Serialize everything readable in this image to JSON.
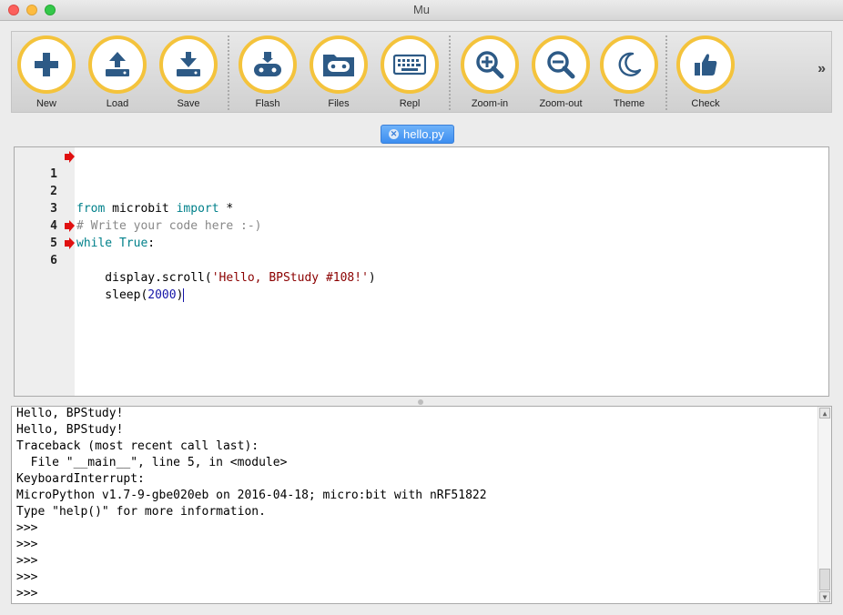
{
  "window": {
    "title": "Mu"
  },
  "toolbar": {
    "buttons": [
      {
        "label": "New",
        "icon": "plus-icon"
      },
      {
        "label": "Load",
        "icon": "upload-icon"
      },
      {
        "label": "Save",
        "icon": "download-icon"
      },
      {
        "label": "Flash",
        "icon": "flash-device-icon"
      },
      {
        "label": "Files",
        "icon": "files-device-icon"
      },
      {
        "label": "Repl",
        "icon": "keyboard-icon"
      },
      {
        "label": "Zoom-in",
        "icon": "zoom-in-icon"
      },
      {
        "label": "Zoom-out",
        "icon": "zoom-out-icon"
      },
      {
        "label": "Theme",
        "icon": "moon-icon"
      },
      {
        "label": "Check",
        "icon": "thumbs-up-icon"
      }
    ],
    "more_label": "»",
    "icon_color": "#2d5a86",
    "ring_color": "#f4c33c"
  },
  "tab": {
    "label": "hello.py",
    "close": "✕",
    "color": "#3d8ef0"
  },
  "editor": {
    "lines": [
      {
        "num": "1",
        "marker": true,
        "kw1": "from",
        "t1": " microbit ",
        "kw2": "import",
        "t2": " *"
      },
      {
        "num": "2",
        "marker": false
      },
      {
        "num": "3",
        "marker": false,
        "comment": "# Write your code here :-)"
      },
      {
        "num": "4",
        "marker": false,
        "kw1": "while",
        "t1": " ",
        "kw2": "True",
        "t2": ":"
      },
      {
        "num": "5",
        "marker": true,
        "pre": "    display.scroll(",
        "str": "'Hello, BPStudy #108!'",
        "post": ")"
      },
      {
        "num": "6",
        "marker": true,
        "pre": "    sleep(",
        "numlit": "2000",
        "post": ")"
      }
    ],
    "marker_color": "#e01010"
  },
  "repl": {
    "lines": [
      "Hello, BPStudy!",
      "Hello, BPStudy!",
      "Traceback (most recent call last):",
      "  File \"__main__\", line 5, in <module>",
      "KeyboardInterrupt:",
      "MicroPython v1.7-9-gbe020eb on 2016-04-18; micro:bit with nRF51822",
      "Type \"help()\" for more information.",
      ">>>",
      ">>>",
      ">>>",
      ">>>",
      ">>>"
    ]
  }
}
